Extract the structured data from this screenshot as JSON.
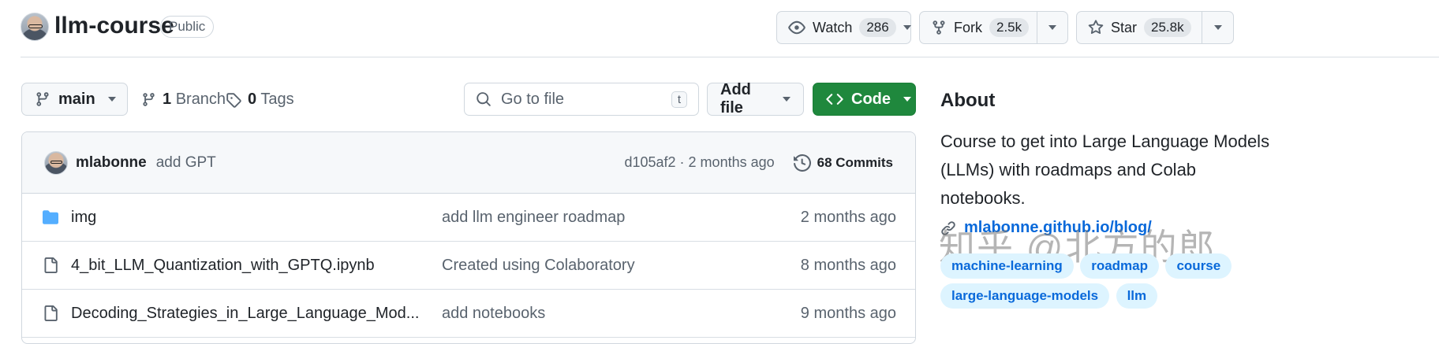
{
  "repo": {
    "name": "llm-course",
    "visibility": "Public"
  },
  "header_actions": {
    "watch": {
      "label": "Watch",
      "count": "286"
    },
    "fork": {
      "label": "Fork",
      "count": "2.5k"
    },
    "star": {
      "label": "Star",
      "count": "25.8k"
    }
  },
  "toolbar": {
    "branch": "main",
    "branches": {
      "count": "1",
      "label": "Branch"
    },
    "tags": {
      "count": "0",
      "label": "Tags"
    },
    "search_placeholder": "Go to file",
    "search_shortcut": "t",
    "add_file": "Add file",
    "code": "Code"
  },
  "latest_commit": {
    "author": "mlabonne",
    "message": "add GPT",
    "meta": "d105af2 · 2 months ago",
    "commits": "68 Commits"
  },
  "files": [
    {
      "name": "img",
      "type": "folder",
      "message": "add llm engineer roadmap",
      "age": "2 months ago"
    },
    {
      "name": "4_bit_LLM_Quantization_with_GPTQ.ipynb",
      "type": "file",
      "message": "Created using Colaboratory",
      "age": "8 months ago"
    },
    {
      "name": "Decoding_Strategies_in_Large_Language_Mod...",
      "type": "file",
      "message": "add notebooks",
      "age": "9 months ago"
    }
  ],
  "about": {
    "title": "About",
    "description": "Course to get into Large Language Models (LLMs) with roadmaps and Colab notebooks.",
    "link": "mlabonne.github.io/blog/",
    "topics": [
      "machine-learning",
      "roadmap",
      "course",
      "large-language-models",
      "llm"
    ]
  },
  "watermark": "知乎 @北方的郎",
  "colors": {
    "accent": "#0969da",
    "code_button": "#1f883d",
    "folder": "#54aeff",
    "topic_bg": "#ddf4ff"
  }
}
